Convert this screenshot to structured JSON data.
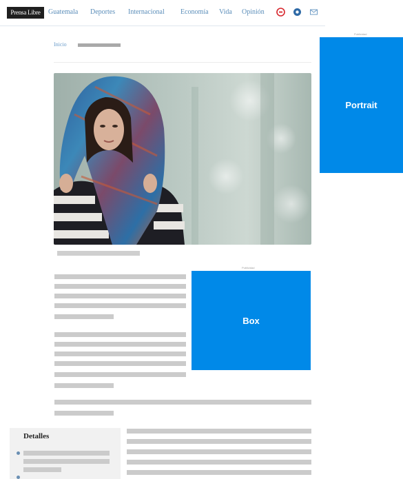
{
  "header": {
    "logo": "Prensa Libre",
    "nav": [
      "Guatemala",
      "Deportes",
      "Internacional",
      "Economía",
      "Vida",
      "Opinión"
    ],
    "icons": [
      "youtube-icon",
      "globe-icon",
      "mail-icon"
    ]
  },
  "breadcrumb": {
    "section": "Inicio"
  },
  "ads": {
    "label": "Publicidad",
    "portrait_label": "Portrait",
    "box_label": "Box",
    "color": "#0089e8"
  },
  "details": {
    "title": "Detalles"
  },
  "colors": {
    "nav_link": "#5a8db9",
    "placeholder": "#cbcbcb"
  }
}
